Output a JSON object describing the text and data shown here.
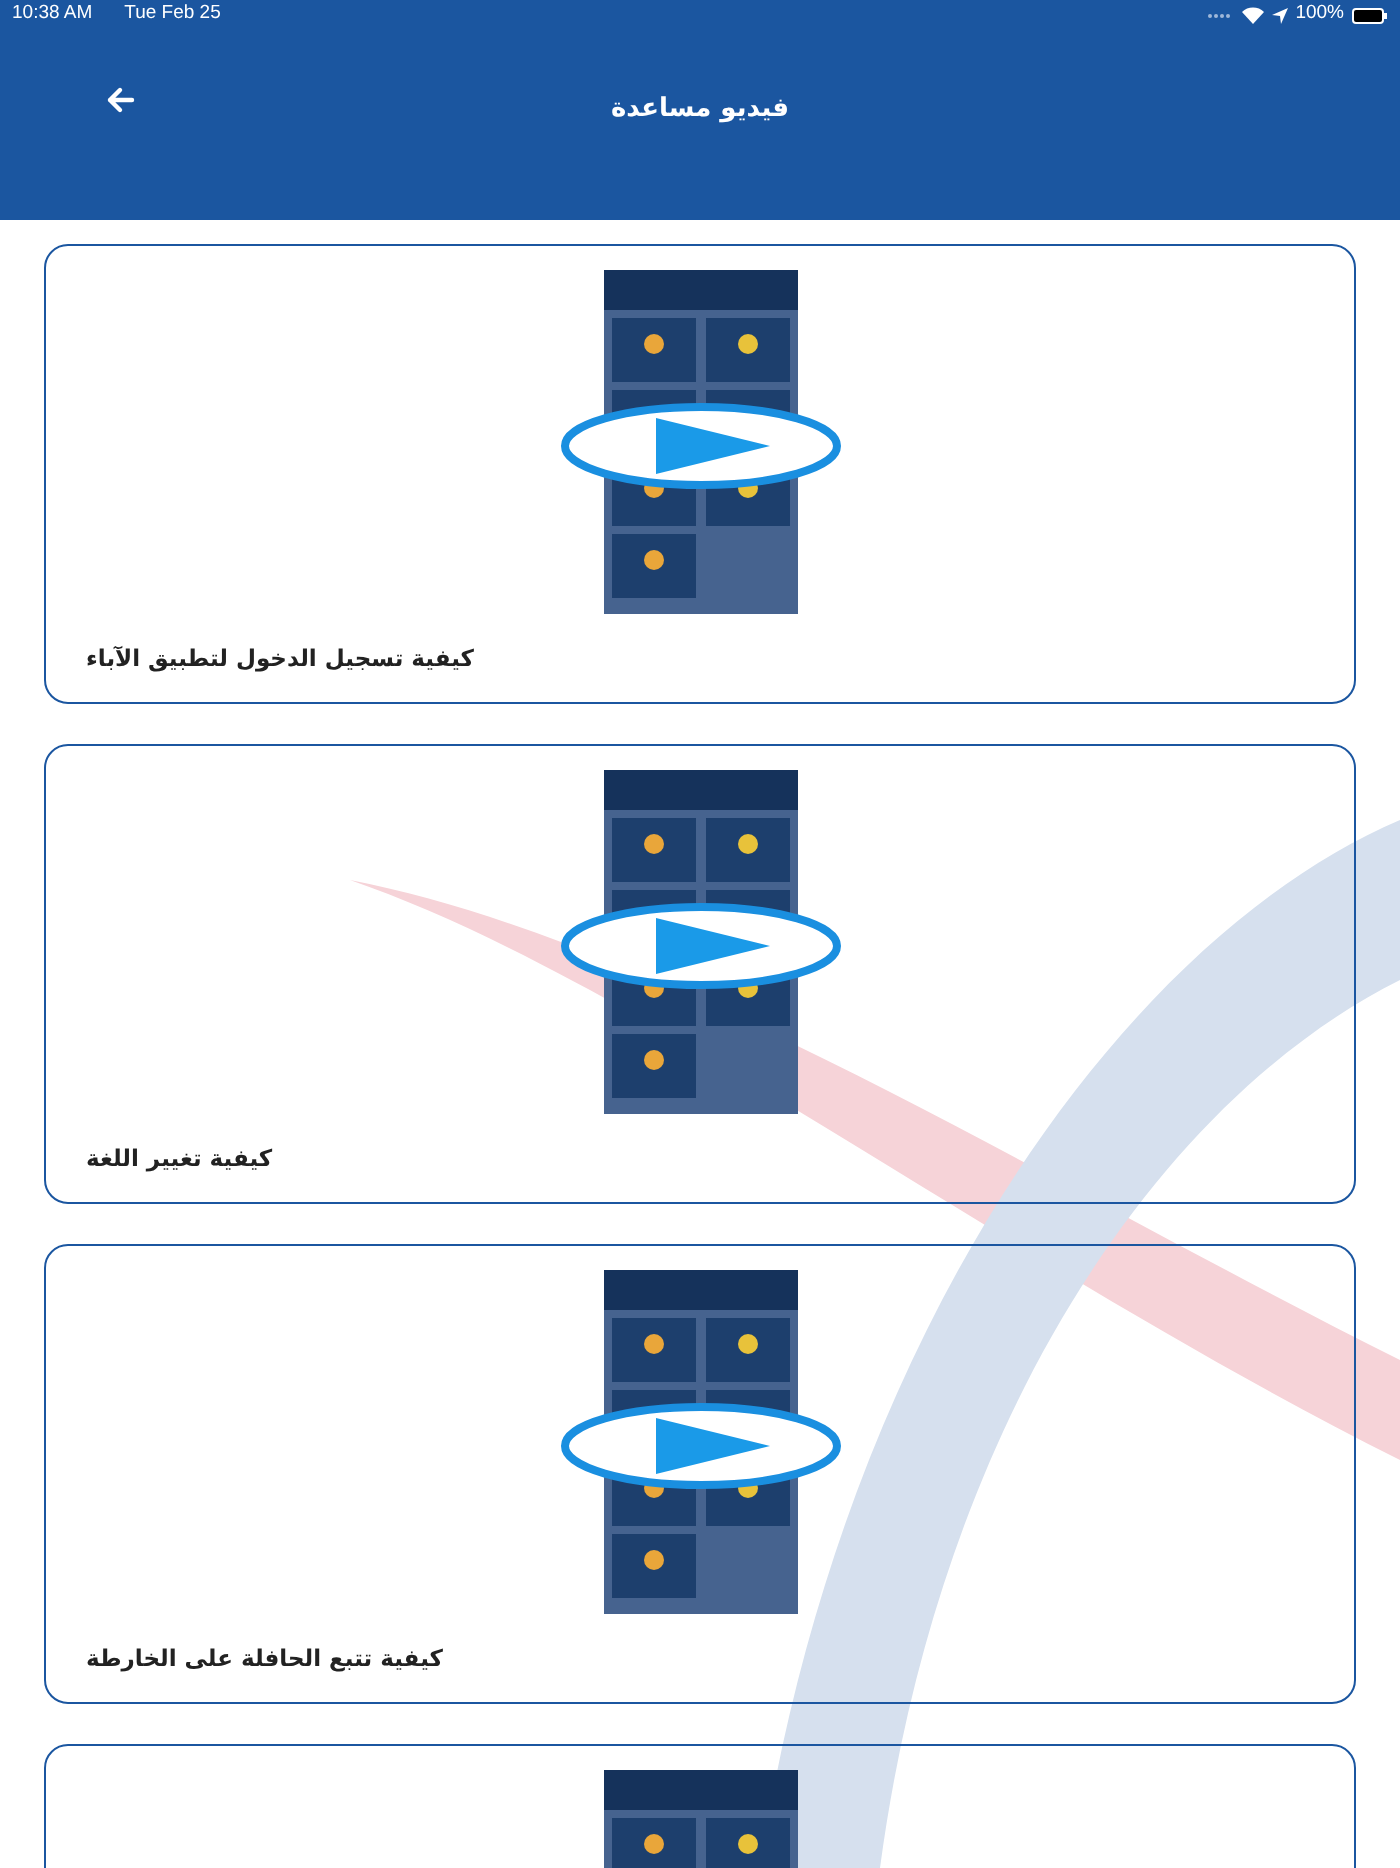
{
  "status_bar": {
    "time": "10:38 AM",
    "date": "Tue Feb 25",
    "battery": "100%"
  },
  "header": {
    "title": "فيديو مساعدة"
  },
  "videos": [
    {
      "kind": "video",
      "title": "كيفية تسجيل الدخول لتطبيق الآباء"
    },
    {
      "kind": "video",
      "title": "كيفية تغيير اللغة"
    },
    {
      "kind": "video",
      "title": "كيفية تتبع الحافلة على الخارطة"
    },
    {
      "kind": "video"
    }
  ]
}
